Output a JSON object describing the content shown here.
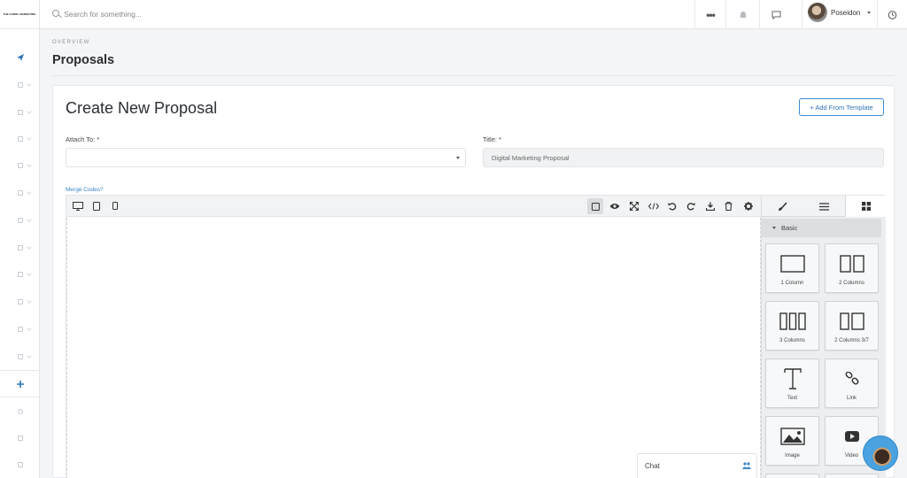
{
  "brand": {
    "logo_text": "THE CHISEL MARKETING"
  },
  "search": {
    "placeholder": "Search for something..."
  },
  "user": {
    "name": "Poseidon"
  },
  "header": {
    "overline": "OVERVIEW",
    "title": "Proposals"
  },
  "form": {
    "heading": "Create New Proposal",
    "template_button": "+ Add From Template",
    "attach_label": "Attach To: *",
    "attach_value": "",
    "title_label": "Title: *",
    "title_value": "Digital Marketing Proposal",
    "merge_codes": "Merge Codes?"
  },
  "blocks_section": "Basic",
  "blocks": [
    {
      "label": "1 Column",
      "icon": "one-column-icon"
    },
    {
      "label": "2 Columns",
      "icon": "two-columns-icon"
    },
    {
      "label": "3 Columns",
      "icon": "three-columns-icon"
    },
    {
      "label": "2 Columns 3/7",
      "icon": "two-columns-37-icon"
    },
    {
      "label": "Text",
      "icon": "text-icon"
    },
    {
      "label": "Link",
      "icon": "link-icon"
    },
    {
      "label": "Image",
      "icon": "image-icon"
    },
    {
      "label": "Video",
      "icon": "video-icon"
    }
  ],
  "chat": {
    "label": "Chat"
  },
  "colors": {
    "accent": "#3a82c9",
    "sidebar_active": "#2f74b5"
  }
}
